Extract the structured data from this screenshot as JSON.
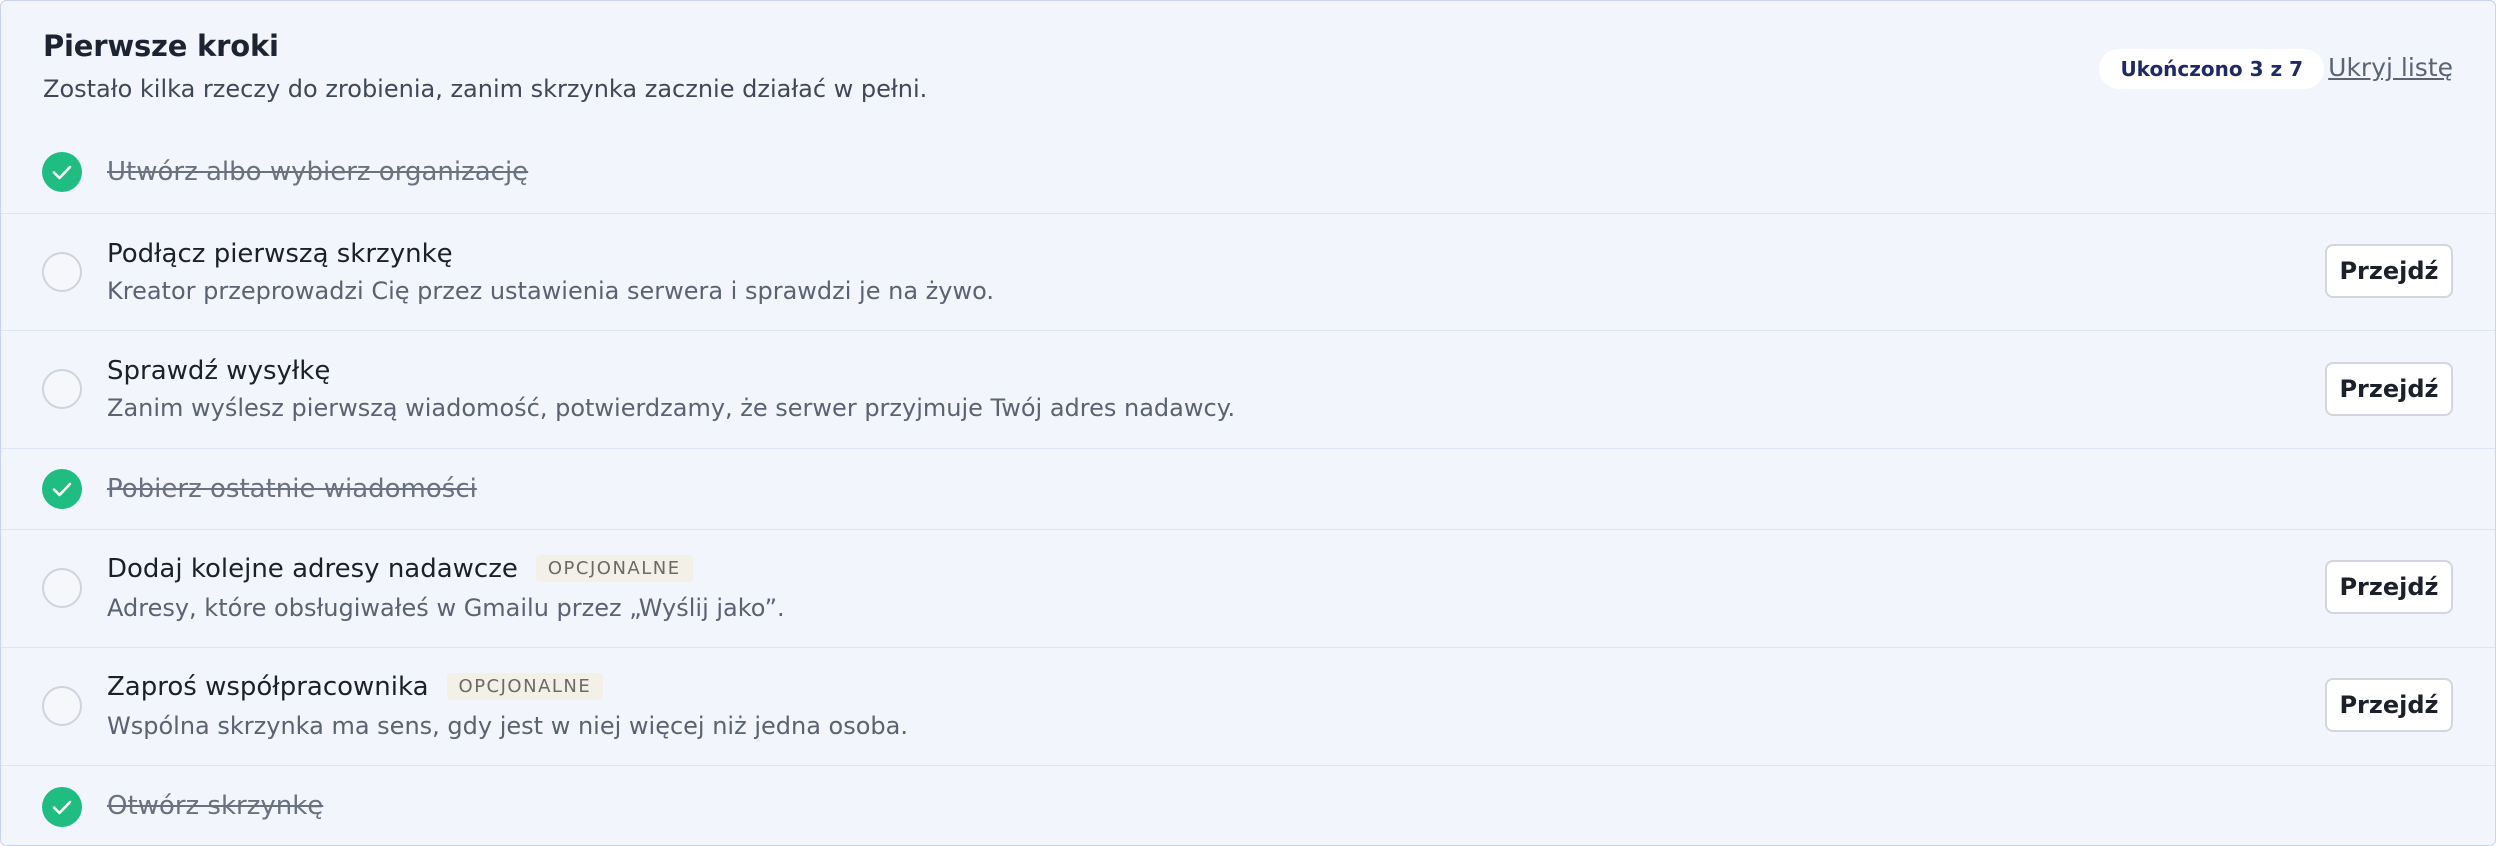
{
  "header": {
    "title": "Pierwsze kroki",
    "subtitle": "Zostało kilka rzeczy do zrobienia, zanim skrzynka zacznie działać w pełni.",
    "progress": "Ukończono 3 z 7",
    "hide_link": "Ukryj listę"
  },
  "colors": {
    "done": "#1fbd82",
    "accent_text": "#1d2a66"
  },
  "steps": [
    {
      "title": "Utwórz albo wybierz organizację",
      "done": true
    },
    {
      "title": "Podłącz pierwszą skrzynkę",
      "desc": "Kreator przeprowadzi Cię przez ustawienia serwera i sprawdzi je na żywo.",
      "done": false,
      "button": "Przejdź"
    },
    {
      "title": "Sprawdź wysyłkę",
      "desc": "Zanim wyślesz pierwszą wiadomość, potwierdzamy, że serwer przyjmuje Twój adres nadawcy.",
      "done": false,
      "button": "Przejdź"
    },
    {
      "title": "Pobierz ostatnie wiadomości",
      "done": true
    },
    {
      "title": "Dodaj kolejne adresy nadawcze",
      "badge": "OPCJONALNE",
      "desc": "Adresy, które obsługiwałeś w Gmailu przez „Wyślij jako”.",
      "done": false,
      "button": "Przejdź"
    },
    {
      "title": "Zaproś współpracownika",
      "badge": "OPCJONALNE",
      "desc": "Wspólna skrzynka ma sens, gdy jest w niej więcej niż jedna osoba.",
      "done": false,
      "button": "Przejdź"
    },
    {
      "title": "Otwórz skrzynkę",
      "done": true
    }
  ]
}
